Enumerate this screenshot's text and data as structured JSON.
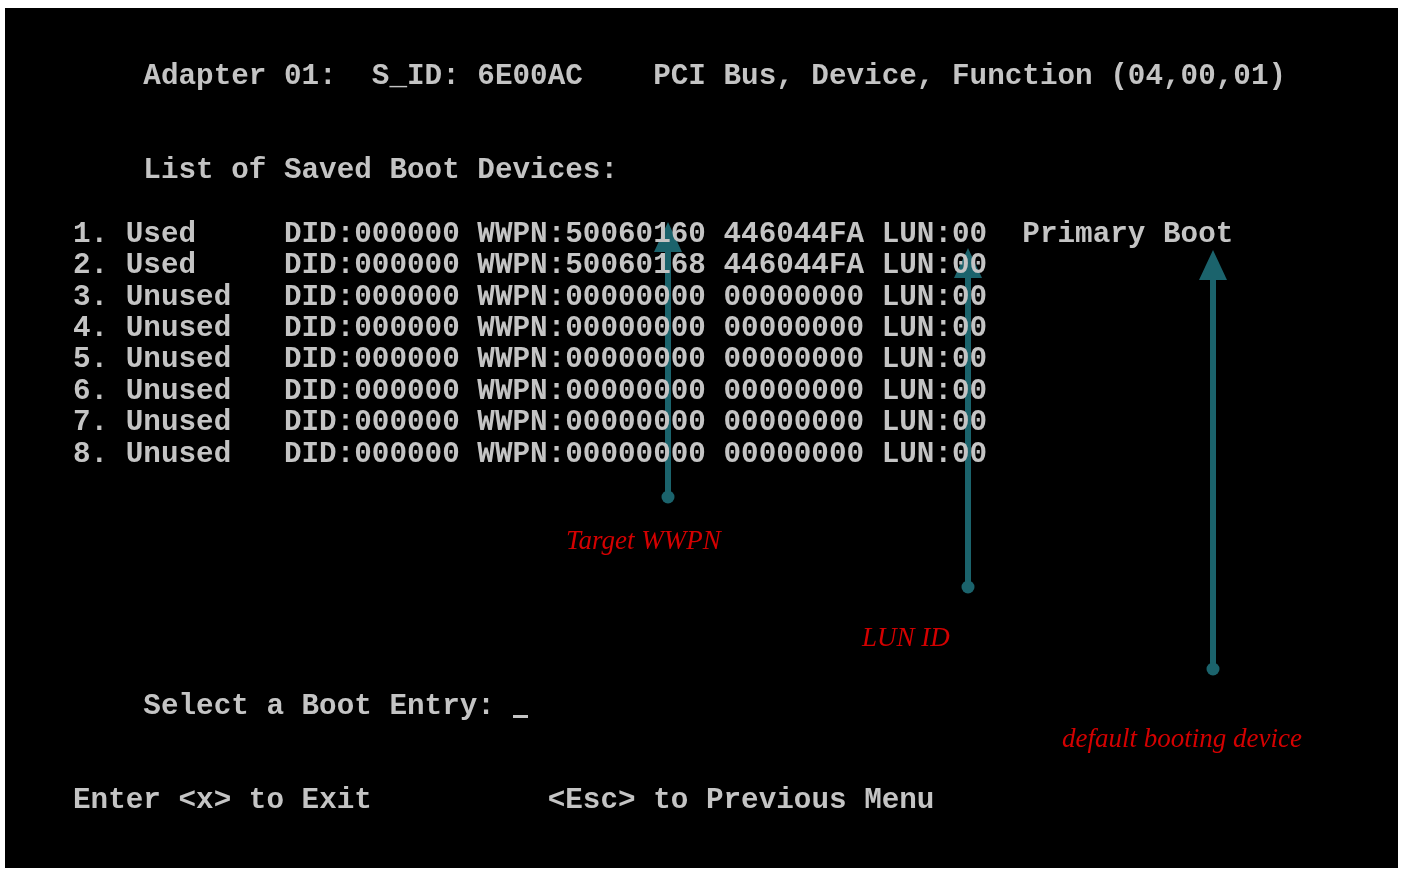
{
  "header": [
    "Adapter 01:",
    "S_ID: 6E00AC",
    "PCI Bus, Device, Function (04,00,01)"
  ],
  "list_title": "List of Saved Boot Devices:",
  "boot_devices": [
    {
      "number": "1.",
      "status": "Used",
      "did": "DID:000000",
      "wwpn": "WWPN:50060160",
      "wwpn_low": "446044FA",
      "lun": "LUN:00",
      "note": "Primary Boot"
    },
    {
      "number": "2.",
      "status": "Used",
      "did": "DID:000000",
      "wwpn": "WWPN:50060168",
      "wwpn_low": "446044FA",
      "lun": "LUN:00"
    },
    {
      "number": "3.",
      "status": "Unused",
      "did": "DID:000000",
      "wwpn": "WWPN:00000000",
      "wwpn_low": "00000000",
      "lun": "LUN:00"
    },
    {
      "number": "4.",
      "status": "Unused",
      "did": "DID:000000",
      "wwpn": "WWPN:00000000",
      "wwpn_low": "00000000",
      "lun": "LUN:00"
    },
    {
      "number": "5.",
      "status": "Unused",
      "did": "DID:000000",
      "wwpn": "WWPN:00000000",
      "wwpn_low": "00000000",
      "lun": "LUN:00"
    },
    {
      "number": "6.",
      "status": "Unused",
      "did": "DID:000000",
      "wwpn": "WWPN:00000000",
      "wwpn_low": "00000000",
      "lun": "LUN:00"
    },
    {
      "number": "7.",
      "status": "Unused",
      "did": "DID:000000",
      "wwpn": "WWPN:00000000",
      "wwpn_low": "00000000",
      "lun": "LUN:00"
    },
    {
      "number": "8.",
      "status": "Unused",
      "did": "DID:000000",
      "wwpn": "WWPN:00000000",
      "wwpn_low": "00000000",
      "lun": "LUN:00"
    }
  ],
  "prompt": "Select a Boot Entry:",
  "footer": [
    "Enter <x> to Exit",
    "<Esc> to Previous Menu"
  ],
  "annotations": [
    {
      "kind": "wwpn",
      "label": "Target WWPN"
    },
    {
      "kind": "lun",
      "label": "LUN ID"
    },
    {
      "kind": "note",
      "label": "default booting device"
    }
  ]
}
